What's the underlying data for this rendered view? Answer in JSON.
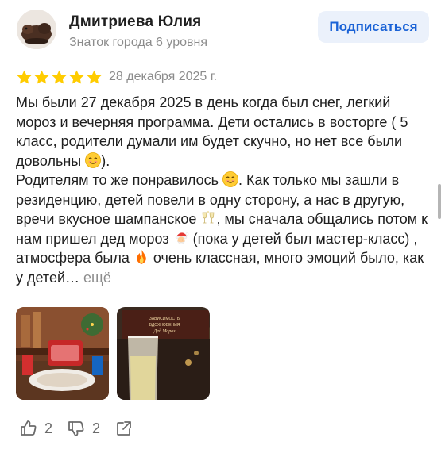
{
  "author": {
    "name": "Дмитриева  Юлия",
    "level": "Знаток города 6 уровня",
    "avatar_icon": "avatar-photo"
  },
  "subscribe_button": "Подписаться",
  "review": {
    "rating": 5,
    "date": "28 декабря 2025 г.",
    "paragraph1_a": "Мы были 27 декабря 2025 в день когда был снег, легкий мороз и вечерняя программа. Дети остались в восторге ( 5 класс, родители думали им будет скучно, но нет все были довольны ",
    "paragraph1_b": ").",
    "paragraph2_a": "Родителям то же понравилось ",
    "paragraph2_b": ". Как только мы зашли в резиденцию, детей повели в одну сторону, а нас в другую, вречи вкусное шампанское ",
    "paragraph2_c": ", мы сначала общались потом к нам пришел дед мороз ",
    "paragraph2_d": " (пока у детей был мастер-класс) , атмосфера была ",
    "paragraph2_e": " очень классная, много эмоций было, как у детей… ",
    "more_link": "ещё",
    "photo_sign_text": "ЗАВИСИМОСТЬ ВДОХНОВЕНИЯ ДЕД МОРОЗ"
  },
  "actions": {
    "likes": "2",
    "dislikes": "2"
  },
  "colors": {
    "accent": "#1a62d6",
    "star": "#fc0",
    "muted": "#8c8c8c"
  }
}
